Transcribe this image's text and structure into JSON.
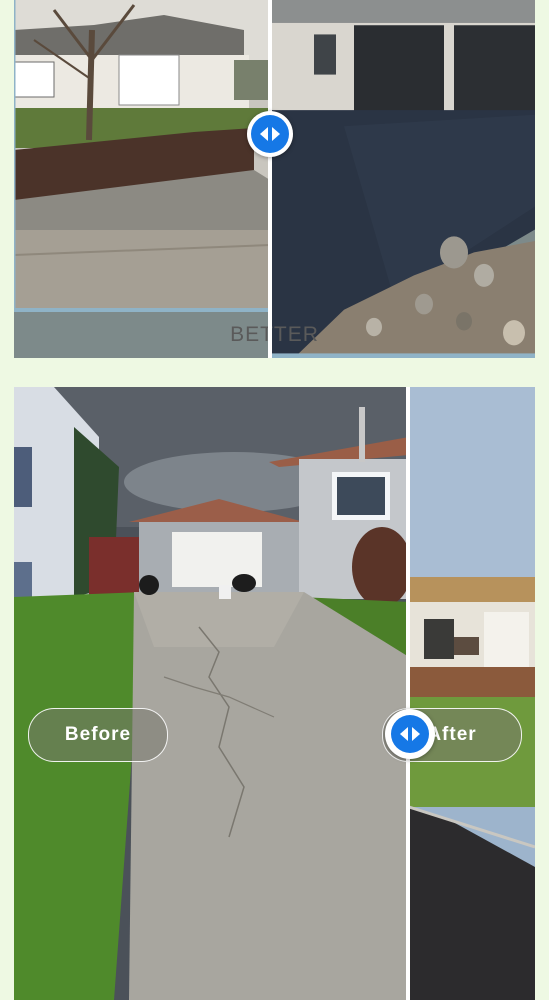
{
  "top_comparison": {
    "caption": "BETTER",
    "handle_icon": "left-right-arrows-icon"
  },
  "bottom_comparison": {
    "before_label": "Before",
    "after_label": "After",
    "handle_icon": "left-right-arrows-icon"
  },
  "colors": {
    "page_background": "#eef9e3",
    "handle_blue": "#1678e6",
    "caption_band": "#eae0da"
  }
}
